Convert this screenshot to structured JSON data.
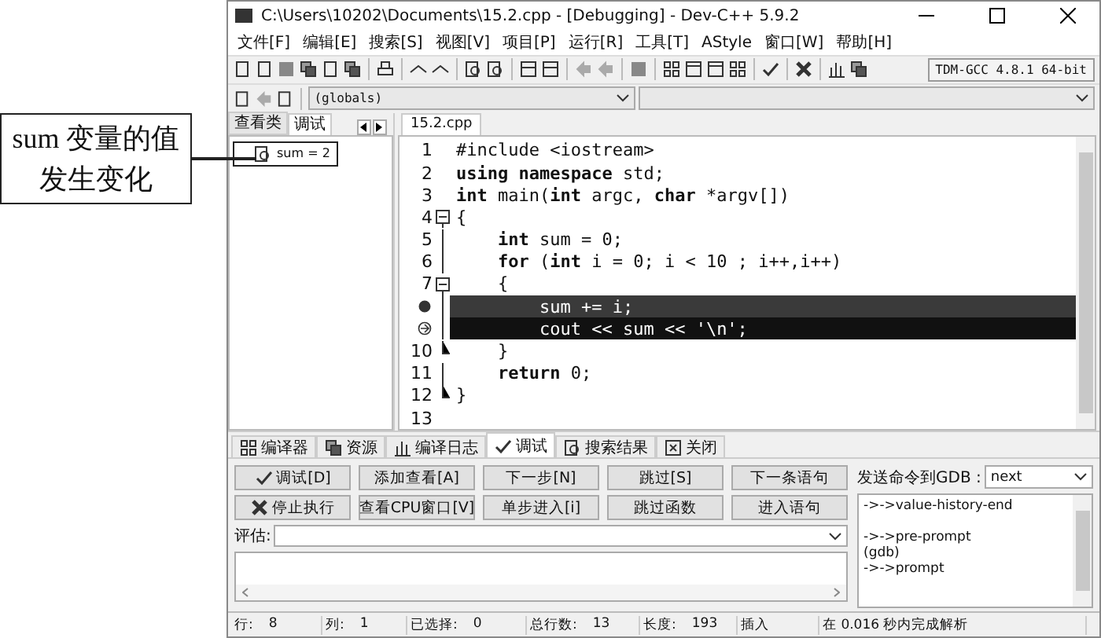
{
  "callout": {
    "text": "sum 变量的值发生变化"
  },
  "window": {
    "title": "C:\\Users\\10202\\Documents\\15.2.cpp - [Debugging] - Dev-C++ 5.9.2"
  },
  "menu": [
    "文件[F]",
    "编辑[E]",
    "搜索[S]",
    "视图[V]",
    "项目[P]",
    "运行[R]",
    "工具[T]",
    "AStyle",
    "窗口[W]",
    "帮助[H]"
  ],
  "compiler": {
    "value": "TDM-GCC 4.8.1 64-bit"
  },
  "scope": {
    "value": "(globals)"
  },
  "left_panel": {
    "tabs": [
      {
        "label": "查看类",
        "selected": false
      },
      {
        "label": "调试",
        "selected": true
      }
    ],
    "watch_items": [
      {
        "text": "sum = 2",
        "annotated": true
      }
    ]
  },
  "editor": {
    "tabs": [
      {
        "label": "15.2.cpp",
        "selected": true
      }
    ],
    "lines": [
      {
        "kind": "normal",
        "number": "1",
        "fold_start": false,
        "fold_end": false,
        "code": "#include <iostream>"
      },
      {
        "kind": "normal",
        "number": "2",
        "fold_start": false,
        "fold_end": false,
        "code": "**using namespace** std;"
      },
      {
        "kind": "normal",
        "number": "3",
        "fold_start": false,
        "fold_end": false,
        "code": "**int** main(**int** argc, **char** *argv[])"
      },
      {
        "kind": "normal",
        "number": "4",
        "fold_start": true,
        "fold_end": false,
        "code": "{"
      },
      {
        "kind": "normal",
        "number": "5",
        "fold_start": false,
        "fold_end": false,
        "code": "    **int** sum = 0;"
      },
      {
        "kind": "normal",
        "number": "6",
        "fold_start": false,
        "fold_end": false,
        "code": "    **for** (**int** i = 0; i < 10 ; i++,i++)"
      },
      {
        "kind": "normal",
        "number": "7",
        "fold_start": true,
        "fold_end": false,
        "code": "    {"
      },
      {
        "kind": "breakpoint",
        "fold_start": false,
        "fold_end": false,
        "code": "        sum += i;"
      },
      {
        "kind": "current",
        "fold_start": false,
        "fold_end": false,
        "code": "        cout << sum << '\\n';"
      },
      {
        "kind": "normal",
        "number": "10",
        "fold_start": false,
        "fold_end": true,
        "code": "    }"
      },
      {
        "kind": "normal",
        "number": "11",
        "fold_start": false,
        "fold_end": false,
        "code": "    **return** 0;"
      },
      {
        "kind": "normal",
        "number": "12",
        "fold_start": false,
        "fold_end": true,
        "code": "}"
      },
      {
        "kind": "normal",
        "number": "13",
        "fold_start": false,
        "fold_end": false
      }
    ]
  },
  "bottom_tabs": [
    {
      "label": "编译器",
      "selected": false
    },
    {
      "label": "资源",
      "selected": false
    },
    {
      "label": "编译日志",
      "selected": false
    },
    {
      "label": "调试",
      "selected": true
    },
    {
      "label": "搜索结果",
      "selected": false
    },
    {
      "label": "关闭",
      "selected": false
    }
  ],
  "debug_buttons": [
    [
      "调试[D]",
      "添加查看[A]",
      "下一步[N]",
      "跳过[S]",
      "下一条语句"
    ],
    [
      "停止执行",
      "查看CPU窗口[V]",
      "单步进入[i]",
      "跳过函数",
      "进入语句"
    ]
  ],
  "evaluate": {
    "label": "评估:"
  },
  "gdb": {
    "label": "发送命令到GDB :",
    "value": "next",
    "log": [
      [
        "->->value-history-end"
      ],
      [
        "->->pre-prompt",
        "(gdb)",
        "->->prompt"
      ]
    ]
  },
  "status_bar": [
    {
      "label": "行:",
      "value": "8"
    },
    {
      "label": "列:",
      "value": "1"
    },
    {
      "label": "已选择:",
      "value": "0"
    },
    {
      "label": "总行数:",
      "value": "13"
    },
    {
      "label": "长度:",
      "value": "193"
    },
    {
      "label": "插入"
    },
    {
      "label": "在 0.016 秒内完成解析"
    }
  ]
}
